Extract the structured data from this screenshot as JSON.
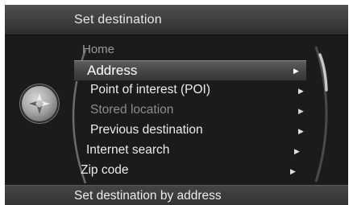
{
  "header": {
    "title": "Set destination"
  },
  "menu": {
    "items": [
      {
        "label": "Home",
        "state": "dim"
      },
      {
        "label": "Address",
        "state": "selected",
        "has_arrow": true
      },
      {
        "label": "Point of interest (POI)",
        "state": "normal",
        "has_arrow": true
      },
      {
        "label": "Stored location",
        "state": "disabled",
        "has_arrow": true
      },
      {
        "label": "Previous destination",
        "state": "normal",
        "has_arrow": true
      },
      {
        "label": "Internet search",
        "state": "normal",
        "has_arrow": true
      },
      {
        "label": "Zip code",
        "state": "normal",
        "has_arrow": true
      }
    ]
  },
  "footer": {
    "hint": "Set destination by address"
  },
  "icons": {
    "knob": "navigation-knob-icon",
    "arrow": "right-triangle-icon",
    "arrow_glyph": "▶"
  }
}
